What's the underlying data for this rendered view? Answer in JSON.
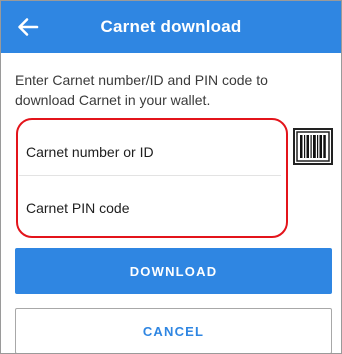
{
  "header": {
    "title": "Carnet download",
    "back_icon": "arrow-left-icon"
  },
  "instructions": "Enter Carnet number/ID and PIN code to download Carnet in your wallet.",
  "form": {
    "carnet_number": {
      "placeholder": "Carnet number or ID",
      "value": ""
    },
    "pin_code": {
      "placeholder": "Carnet PIN code",
      "value": ""
    },
    "scan_icon": "barcode-icon"
  },
  "actions": {
    "download_label": "DOWNLOAD",
    "cancel_label": "CANCEL"
  },
  "colors": {
    "accent": "#2f86e2",
    "highlight": "#e3141b"
  }
}
